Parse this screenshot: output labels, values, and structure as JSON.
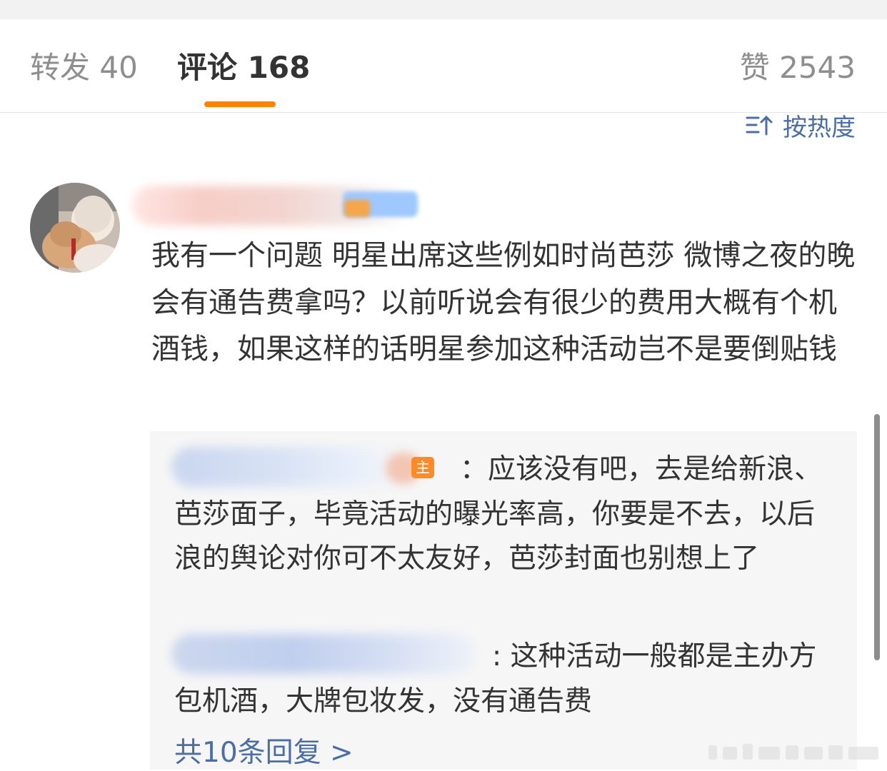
{
  "tabs": {
    "reposts": "转发 40",
    "comments": "评论 168",
    "likes": "赞 2543"
  },
  "sort": {
    "label": "按热度",
    "icon": "sort-icon"
  },
  "comment": {
    "text": "我有一个问题 明星出席这些例如时尚芭莎 微博之夜的晚会有通告费拿吗？以前听说会有很少的费用大概有个机酒钱，如果这样的话明星参加这种活动岂不是要倒贴钱"
  },
  "replies": [
    {
      "badge": "主",
      "text": "：应该没有吧，去是给新浪、芭莎面子，毕竟活动的曝光率高，你要是不去，以后浪的舆论对你可不太友好，芭莎封面也别想上了"
    },
    {
      "text": ": 这种活动一般都是主办方包机酒，大牌包妆发，没有通告费"
    }
  ],
  "more_replies": "共10条回复 >",
  "colors": {
    "accent": "#ff8200",
    "link": "#4b6ea4",
    "text": "#333333",
    "muted": "#8e8e8e"
  }
}
